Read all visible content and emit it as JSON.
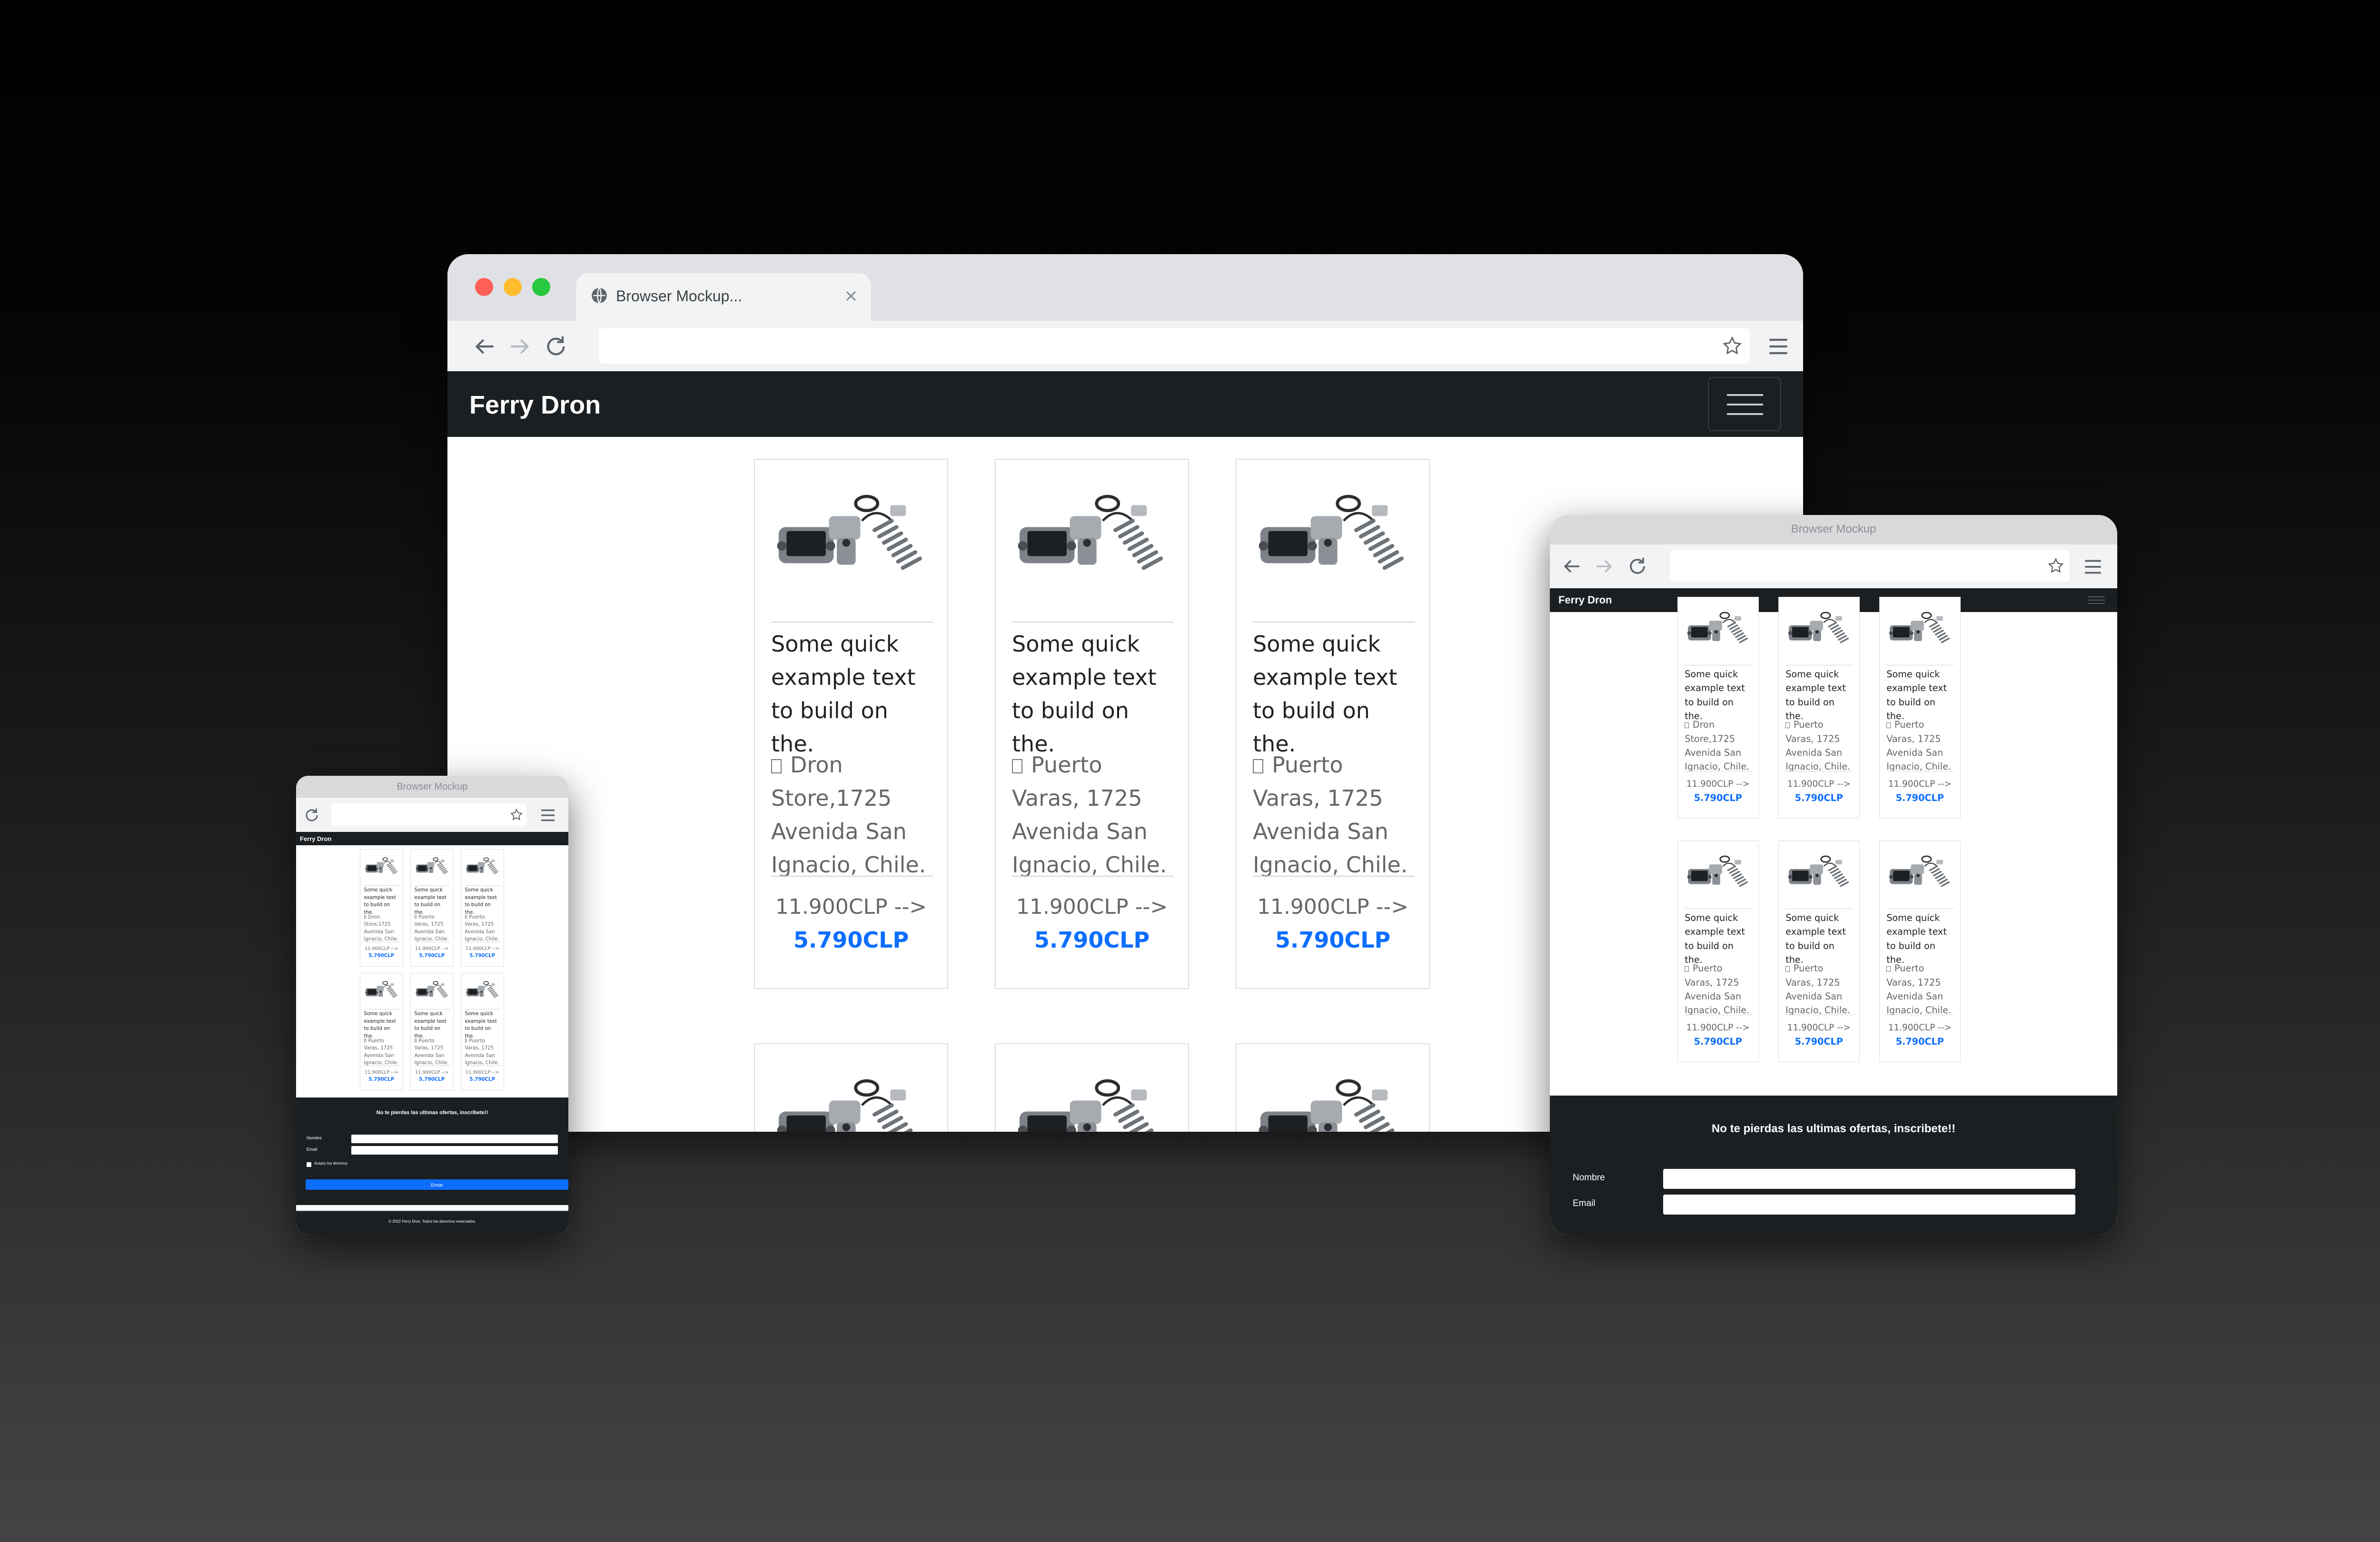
{
  "desktop": {
    "tab_title": "Browser Mockup...",
    "brand": "Ferry Dron",
    "products": [
      {
        "title": "Some quick example text to build on the.",
        "location": "Dron Store,1725 Avenida San Ignacio, Chile.",
        "old_price": "11.900CLP -->",
        "new_price": "5.790CLP"
      },
      {
        "title": "Some quick example text to build on the.",
        "location": "Puerto Varas, 1725 Avenida San Ignacio, Chile.",
        "old_price": "11.900CLP -->",
        "new_price": "5.790CLP"
      },
      {
        "title": "Some quick example text to build on the.",
        "location": "Puerto Varas, 1725 Avenida San Ignacio, Chile.",
        "old_price": "11.900CLP -->",
        "new_price": "5.790CLP"
      }
    ]
  },
  "tablet": {
    "window_title": "Browser Mockup",
    "brand": "Ferry Dron",
    "products": [
      {
        "title": "Some quick example text to build on the.",
        "location": "Dron Store,1725 Avenida San Ignacio, Chile.",
        "old_price": "11.900CLP -->",
        "new_price": "5.790CLP"
      },
      {
        "title": "Some quick example text to build on the.",
        "location": "Puerto Varas, 1725 Avenida San Ignacio, Chile.",
        "old_price": "11.900CLP -->",
        "new_price": "5.790CLP"
      },
      {
        "title": "Some quick example text to build on the.",
        "location": "Puerto Varas, 1725 Avenida San Ignacio, Chile.",
        "old_price": "11.900CLP -->",
        "new_price": "5.790CLP"
      },
      {
        "title": "Some quick example text to build on the.",
        "location": "Puerto Varas, 1725 Avenida San Ignacio, Chile.",
        "old_price": "11.900CLP -->",
        "new_price": "5.790CLP"
      },
      {
        "title": "Some quick example text to build on the.",
        "location": "Puerto Varas, 1725 Avenida San Ignacio, Chile.",
        "old_price": "11.900CLP -->",
        "new_price": "5.790CLP"
      },
      {
        "title": "Some quick example text to build on the.",
        "location": "Puerto Varas, 1725 Avenida San Ignacio, Chile.",
        "old_price": "11.900CLP -->",
        "new_price": "5.790CLP"
      }
    ],
    "newsletter": {
      "heading": "No te pierdas las ultimas ofertas, inscribete!!",
      "name_label": "Nombre",
      "email_label": "Email"
    }
  },
  "mobile": {
    "window_title": "Browser Mockup",
    "brand": "Ferry Dron",
    "products": [
      {
        "title": "Some quick example text to build on the.",
        "location": "Dron Store,1725 Avenida San Ignacio, Chile.",
        "old_price": "11.900CLP -->",
        "new_price": "5.790CLP"
      },
      {
        "title": "Some quick example text to build on the.",
        "location": "Puerto Varas, 1725 Avenida San Ignacio, Chile.",
        "old_price": "11.900CLP -->",
        "new_price": "5.790CLP"
      },
      {
        "title": "Some quick example text to build on the.",
        "location": "Puerto Varas, 1725 Avenida San Ignacio, Chile.",
        "old_price": "11.900CLP -->",
        "new_price": "5.790CLP"
      },
      {
        "title": "Some quick example text to build on the.",
        "location": "Puerto Varas, 1725 Avenida San Ignacio, Chile.",
        "old_price": "11.900CLP -->",
        "new_price": "5.790CLP"
      },
      {
        "title": "Some quick example text to build on the.",
        "location": "Puerto Varas, 1725 Avenida San Ignacio, Chile.",
        "old_price": "11.900CLP -->",
        "new_price": "5.790CLP"
      },
      {
        "title": "Some quick example text to build on the.",
        "location": "Puerto Varas, 1725 Avenida San Ignacio, Chile.",
        "old_price": "11.900CLP -->",
        "new_price": "5.790CLP"
      }
    ],
    "newsletter": {
      "heading": "No te pierdas las ultimas ofertas, inscribete!!",
      "name_label": "Nombre",
      "email_label": "Email",
      "checkbox_label": "Acepto los términos",
      "submit_label": "Enviar"
    },
    "footer": "© 2022 Ferry Dron. Todos los derechos reservados."
  },
  "icons": {
    "location": "location-icon",
    "favicon": "globe-icon",
    "back": "arrow-left-icon",
    "forward": "arrow-right-icon",
    "reload": "reload-icon",
    "bookmark": "star-icon",
    "menu": "hamburger-icon"
  },
  "colors": {
    "navbar": "#1b1f22",
    "price_accent": "#0d6efd",
    "mac_close": "#ff5f57",
    "mac_minimize": "#febc2e",
    "mac_zoom": "#28c840"
  }
}
